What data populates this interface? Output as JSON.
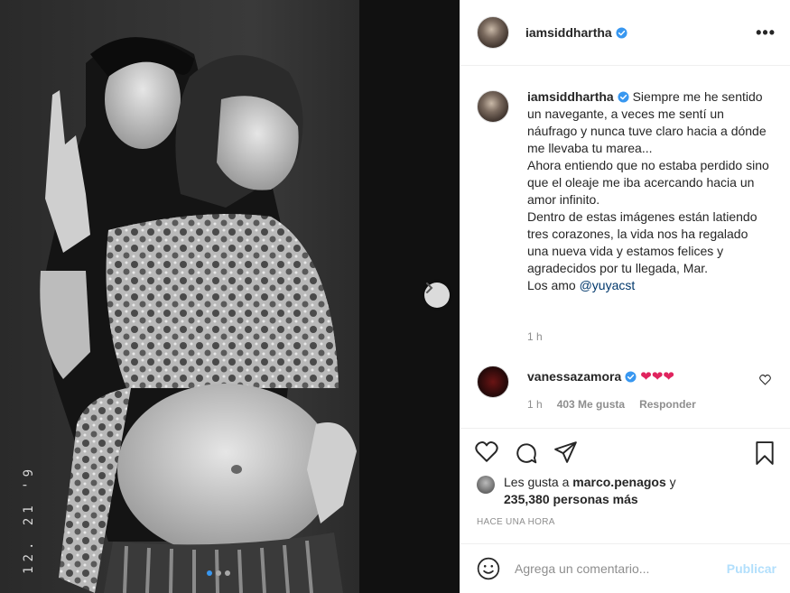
{
  "post": {
    "image_date_stamp": "12. 21 '9",
    "carousel": {
      "total": 3,
      "active": 1
    },
    "next_icon": "chevron-right-icon"
  },
  "header": {
    "username": "iamsiddhartha",
    "verified_icon": "verified-badge-icon",
    "more_icon": "more-options-icon",
    "more_label": "•••"
  },
  "caption": {
    "username": "iamsiddhartha",
    "text": "Siempre me he sentido un navegante, a veces me sentí un náufrago y nunca tuve claro hacia a dónde me llevaba tu marea...\nAhora entiendo que no estaba perdido sino que el oleaje me iba acercando hacia un amor infinito.\nDentro de estas imágenes están latiendo tres corazones, la vida nos ha regalado una nueva vida y estamos felices y agradecidos por tu llegada, Mar.\nLos amo ",
    "mention": "@yuyacst",
    "time": "1 h"
  },
  "comment": {
    "username": "vanessazamora",
    "text": "❤❤❤",
    "time": "1 h",
    "likes": "403 Me gusta",
    "reply_label": "Responder",
    "like_icon": "heart-outline-icon"
  },
  "actions": {
    "like_icon": "heart-outline-icon",
    "comment_icon": "comment-icon",
    "share_icon": "paper-plane-icon",
    "save_icon": "bookmark-icon"
  },
  "likes": {
    "prefix": "Les gusta a ",
    "user": "marco.penagos",
    "middle": " y ",
    "count": "235,380 personas más",
    "time_ago": "HACE UNA HORA"
  },
  "comment_box": {
    "placeholder": "Agrega un comentario...",
    "publish_label": "Publicar",
    "emoji_icon": "smiley-icon"
  },
  "colors": {
    "verified": "#3897f0",
    "mention": "#00376b",
    "heart": "#e0245e",
    "publish_disabled": "#b2dffc",
    "muted": "#8e8e8e"
  }
}
